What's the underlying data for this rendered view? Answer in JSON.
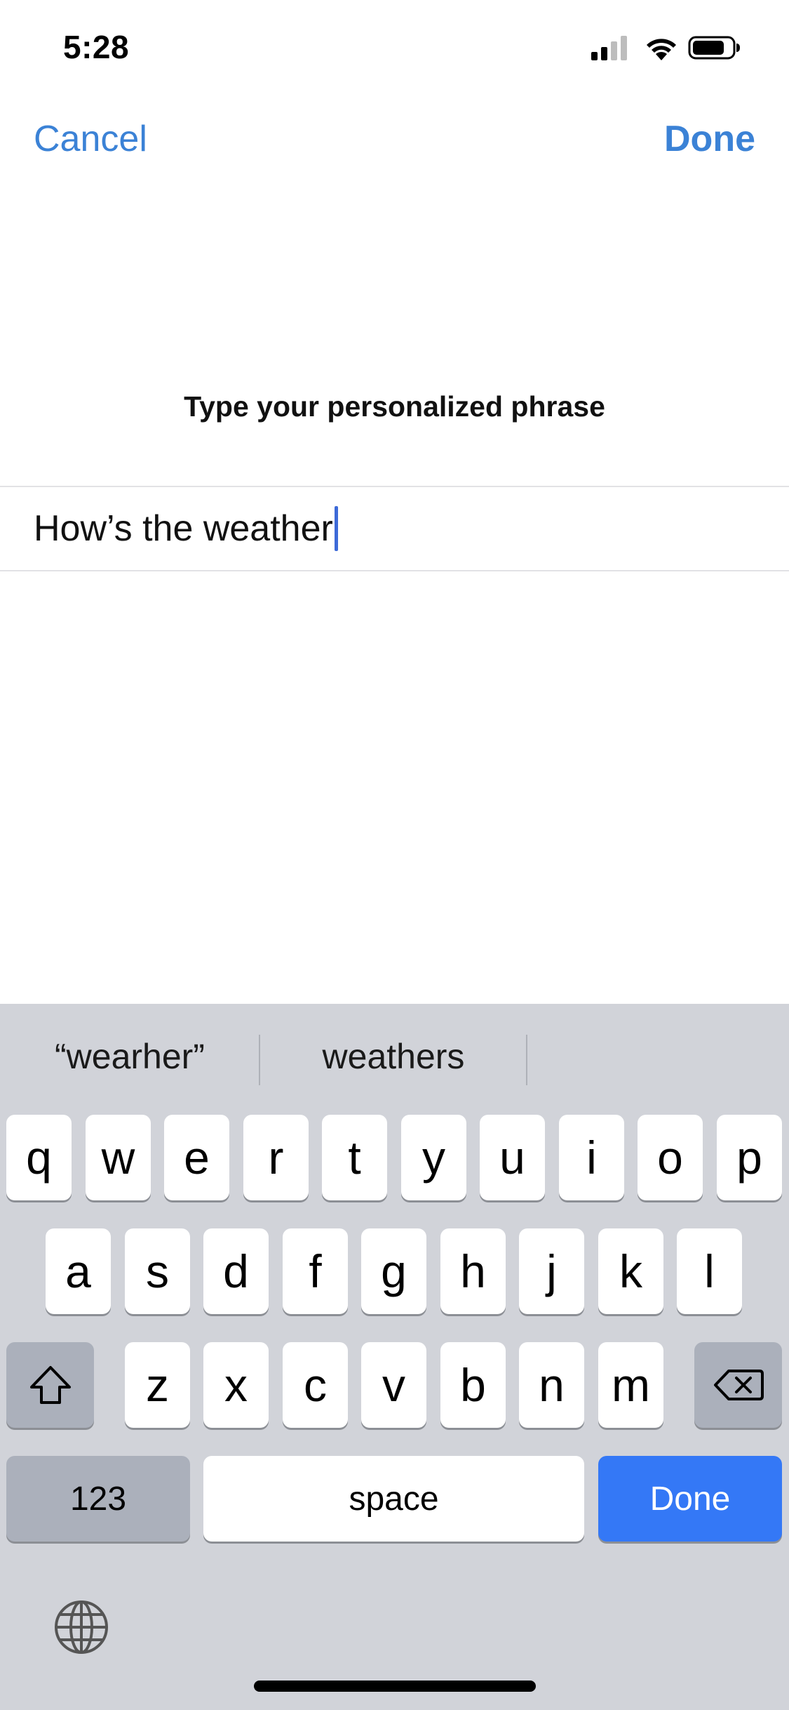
{
  "status_bar": {
    "time": "5:28",
    "icons": [
      "cellular-signal-icon",
      "wifi-icon",
      "battery-icon"
    ]
  },
  "nav": {
    "cancel_label": "Cancel",
    "done_label": "Done"
  },
  "prompt": {
    "title": "Type your personalized phrase"
  },
  "phrase_field": {
    "value": "How’s the weather"
  },
  "keyboard": {
    "suggestions": [
      "“wearher”",
      "weathers",
      ""
    ],
    "row1": [
      "q",
      "w",
      "e",
      "r",
      "t",
      "y",
      "u",
      "i",
      "o",
      "p"
    ],
    "row2": [
      "a",
      "s",
      "d",
      "f",
      "g",
      "h",
      "j",
      "k",
      "l"
    ],
    "row3": [
      "z",
      "x",
      "c",
      "v",
      "b",
      "n",
      "m"
    ],
    "numbers_label": "123",
    "space_label": "space",
    "done_label": "Done",
    "icons": [
      "shift-icon",
      "delete-icon",
      "globe-icon"
    ]
  },
  "colors": {
    "accent": "#3b82d6",
    "key_blue": "#3478f6",
    "keyboard_bg": "#d1d3d9",
    "key_dark": "#abb0bb",
    "caret": "#3d6ad8"
  }
}
